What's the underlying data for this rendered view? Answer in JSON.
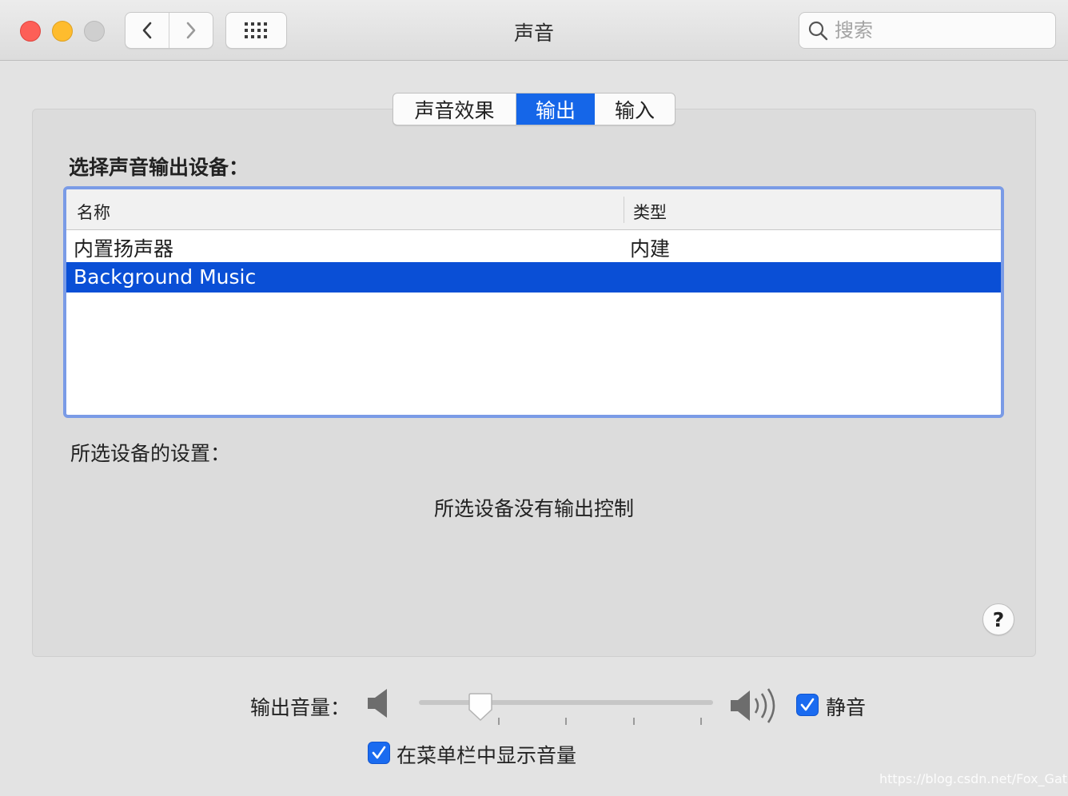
{
  "window": {
    "title": "声音"
  },
  "search": {
    "placeholder": "搜索"
  },
  "tabs": [
    {
      "label": "声音效果",
      "selected": false
    },
    {
      "label": "输出",
      "selected": true
    },
    {
      "label": "输入",
      "selected": false
    }
  ],
  "output": {
    "section_label": "选择声音输出设备：",
    "columns": [
      "名称",
      "类型"
    ],
    "devices": [
      {
        "name": "内置扬声器",
        "type": "内建",
        "selected": false
      },
      {
        "name": "Background Music",
        "type": "",
        "selected": true
      }
    ],
    "settings_label": "所选设备的设置：",
    "no_control_text": "所选设备没有输出控制"
  },
  "help": {
    "label": "?"
  },
  "volume": {
    "label": "输出音量：",
    "level_fraction": 0.21,
    "mute_label": "静音",
    "mute_checked": true
  },
  "menubar": {
    "show_volume_label": "在菜单栏中显示音量",
    "checked": true
  },
  "watermark": "https://blog.csdn.net/Fox_Gates",
  "colors": {
    "accent": "#1566e8",
    "selection": "#0a4fd6",
    "table_focus_ring": "#7a9be6"
  }
}
